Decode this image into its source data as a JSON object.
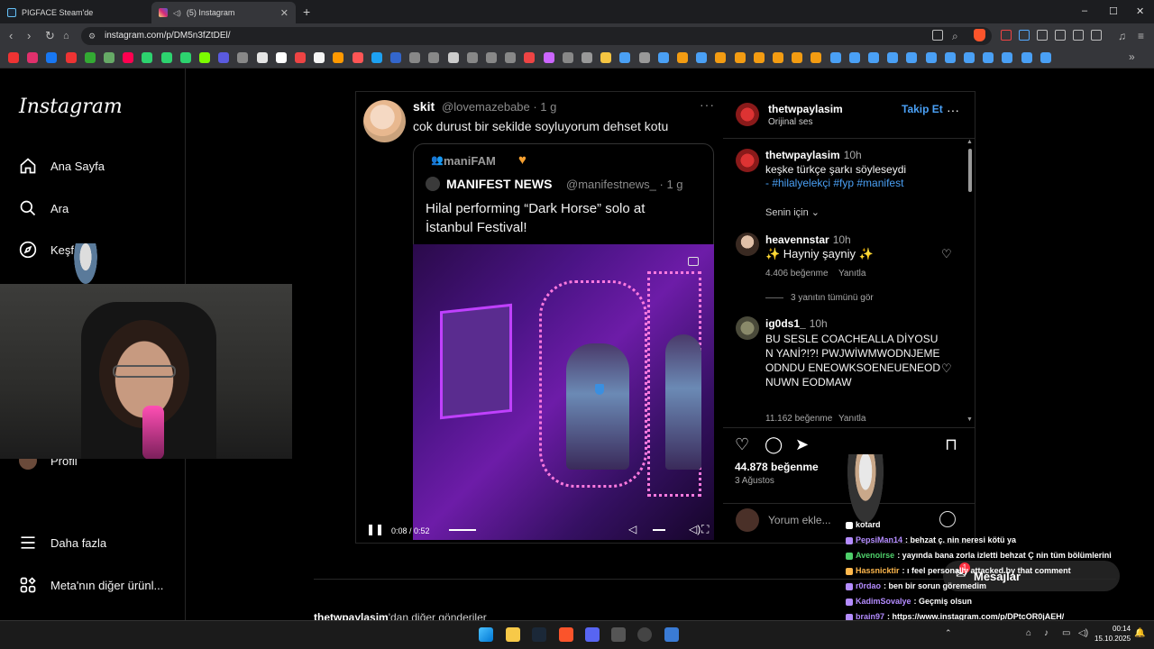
{
  "browser": {
    "tabs": [
      {
        "label": "PIGFACE Steam'de",
        "active": false
      },
      {
        "label": "(5) Instagram",
        "active": true
      }
    ],
    "new_tab": "+",
    "url": "instagram.com/p/DM5n3fZtDEl/",
    "window_controls": [
      "–",
      "☐",
      "✕"
    ]
  },
  "sidebar": {
    "logo": "Instagram",
    "items": [
      {
        "label": "Ana Sayfa",
        "icon": "home-icon"
      },
      {
        "label": "Ara",
        "icon": "search-icon"
      },
      {
        "label": "Keşfet",
        "icon": "explore-icon"
      },
      {
        "label": "Profil",
        "icon": "avatar"
      },
      {
        "label": "Daha fazla",
        "icon": "menu-icon"
      },
      {
        "label": "Meta'nın diğer ürünl...",
        "icon": "meta-apps-icon"
      }
    ]
  },
  "tweet": {
    "name": "skit",
    "handle": "@lovemazebabe · 1 g",
    "text": "cok durust bir sekilde soyluyorum dehset kotu",
    "quote": {
      "community": "maniFAM",
      "name": "MANIFEST NEWS",
      "handle": "@manifestnews_ · 1 g",
      "text": "Hilal performing “Dark Horse” solo at İstanbul Festival!"
    },
    "video_time": "0:08 / 0:52",
    "progress": 0.15
  },
  "comments_panel": {
    "author": "thetwpaylasim",
    "audio": "Orijinal ses",
    "follow": "Takip Et",
    "caption": {
      "user": "thetwpaylasim",
      "time": "10h",
      "text": "keşke türkçe şarkı söyleseydi",
      "hashtags": "- #hilalyelekçi #fyp #manifest"
    },
    "for_you": "Senin için",
    "comments": [
      {
        "user": "heavennstar",
        "time": "10h",
        "text": "✨ Hayniy şayniy ✨",
        "likes": "4.406 beğenme",
        "reply": "Yanıtla",
        "view_replies": "3 yanıtın tümünü gör"
      },
      {
        "user": "ig0ds1_",
        "time": "10h",
        "text": "BU SESLE COACHEALLA DİYOSUN YANİ?!?! PWJWİWMWODNJEMEODNDU ENEOWKSOENEUENEODNUWN EODMAW",
        "likes": "11.162 beğenme",
        "reply": "Yanıtla"
      }
    ],
    "total_likes": "44.878 beğenme",
    "date": "3 Ağustos",
    "comment_placeholder": "Yorum ekle..."
  },
  "more_posts": {
    "user": "thetwpaylasim",
    "suffix": "'dan diğer gönderiler"
  },
  "chat": {
    "messages": [
      {
        "user": "kotard",
        "text": "",
        "color": "#ffffff"
      },
      {
        "user": "PepsiMan14",
        "text": ": behzat ç. nin neresi kötü ya",
        "color": "#b48cff"
      },
      {
        "user": "Avenoirse",
        "text": ": yayında bana zorla izletti behzat Ç nin tüm bölümlerini",
        "color": "#4fd06b"
      },
      {
        "user": "Hassnicktir",
        "text": ": ı feel personally attacked by that comment",
        "color": "#ffb84d"
      },
      {
        "user": "r0rdao",
        "text": ": ben bir sorun göremedim",
        "color": "#b48cff"
      },
      {
        "user": "KadimSovalye",
        "text": ": Geçmiş olsun",
        "color": "#b48cff"
      },
      {
        "user": "brain97",
        "text": ": https://www.instagram.com/p/DPtcOR0jAEH/",
        "color": "#b48cff"
      }
    ],
    "messages_pill": "Mesajlar",
    "badge_count": "1"
  },
  "taskbar": {
    "time": "00:14",
    "date": "15.10.2025"
  },
  "colors": {
    "accent_blue": "#4aa0f5",
    "brave_orange": "#fb542b"
  }
}
